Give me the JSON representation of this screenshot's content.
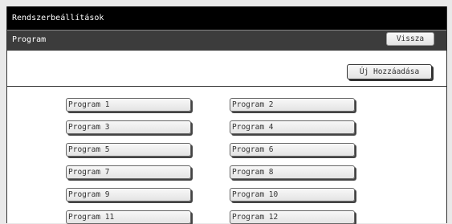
{
  "header": {
    "title": "Rendszerbeállítások"
  },
  "subheader": {
    "label": "Program",
    "back_label": "Vissza"
  },
  "actions": {
    "add_label": "Új Hozzáadása"
  },
  "programs": [
    {
      "label": "Program 1"
    },
    {
      "label": "Program 2"
    },
    {
      "label": "Program 3"
    },
    {
      "label": "Program 4"
    },
    {
      "label": "Program 5"
    },
    {
      "label": "Program 6"
    },
    {
      "label": "Program 7"
    },
    {
      "label": "Program 8"
    },
    {
      "label": "Program 9"
    },
    {
      "label": "Program 10"
    },
    {
      "label": "Program 11"
    },
    {
      "label": "Program 12"
    }
  ]
}
